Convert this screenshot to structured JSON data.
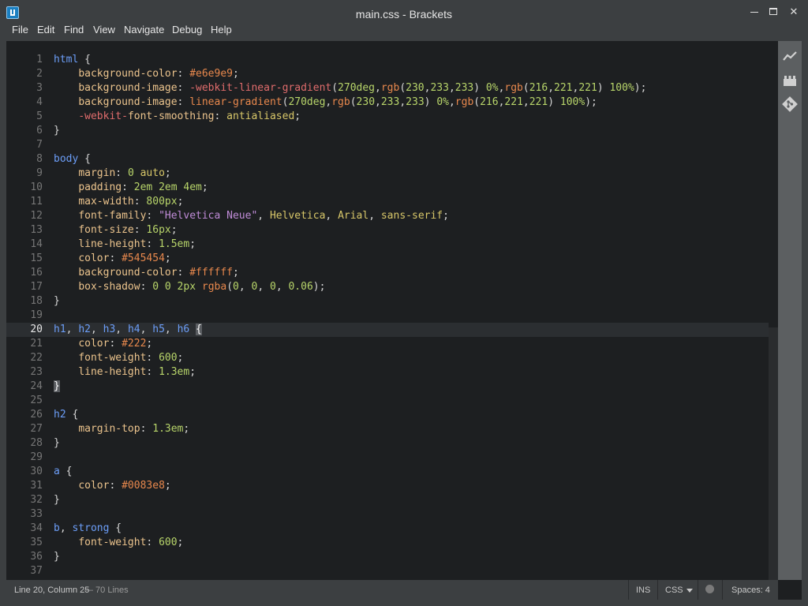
{
  "window": {
    "title": "main.css - Brackets",
    "minimize_glyph": "",
    "maximize_glyph": "",
    "close_glyph": "✕"
  },
  "menu": [
    {
      "label": "File"
    },
    {
      "label": "Edit"
    },
    {
      "label": "Find"
    },
    {
      "label": "View"
    },
    {
      "label": "Navigate"
    },
    {
      "label": "Debug"
    },
    {
      "label": "Help"
    }
  ],
  "editor": {
    "language": "CSS",
    "active_line": 20,
    "lines": [
      {
        "n": "1",
        "tokens": [
          [
            "sel",
            "html"
          ],
          [
            "punc",
            " {"
          ]
        ]
      },
      {
        "n": "2",
        "tokens": [
          [
            "punc",
            "    "
          ],
          [
            "prop",
            "background-color"
          ],
          [
            "punc",
            ": "
          ],
          [
            "hex",
            "#e6e9e9"
          ],
          [
            "punc",
            ";"
          ]
        ]
      },
      {
        "n": "3",
        "tokens": [
          [
            "punc",
            "    "
          ],
          [
            "prop",
            "background-image"
          ],
          [
            "punc",
            ": "
          ],
          [
            "vendor",
            "-webkit-linear-gradient"
          ],
          [
            "punc",
            "("
          ],
          [
            "num",
            "270deg"
          ],
          [
            "punc",
            ","
          ],
          [
            "fn",
            "rgb"
          ],
          [
            "punc",
            "("
          ],
          [
            "num",
            "230"
          ],
          [
            "punc",
            ","
          ],
          [
            "num",
            "233"
          ],
          [
            "punc",
            ","
          ],
          [
            "num",
            "233"
          ],
          [
            "punc",
            ") "
          ],
          [
            "num",
            "0%"
          ],
          [
            "punc",
            ","
          ],
          [
            "fn",
            "rgb"
          ],
          [
            "punc",
            "("
          ],
          [
            "num",
            "216"
          ],
          [
            "punc",
            ","
          ],
          [
            "num",
            "221"
          ],
          [
            "punc",
            ","
          ],
          [
            "num",
            "221"
          ],
          [
            "punc",
            ") "
          ],
          [
            "num",
            "100%"
          ],
          [
            "punc",
            ");"
          ]
        ]
      },
      {
        "n": "4",
        "tokens": [
          [
            "punc",
            "    "
          ],
          [
            "prop",
            "background-image"
          ],
          [
            "punc",
            ": "
          ],
          [
            "fn",
            "linear-gradient"
          ],
          [
            "punc",
            "("
          ],
          [
            "num",
            "270deg"
          ],
          [
            "punc",
            ","
          ],
          [
            "fn",
            "rgb"
          ],
          [
            "punc",
            "("
          ],
          [
            "num",
            "230"
          ],
          [
            "punc",
            ","
          ],
          [
            "num",
            "233"
          ],
          [
            "punc",
            ","
          ],
          [
            "num",
            "233"
          ],
          [
            "punc",
            ") "
          ],
          [
            "num",
            "0%"
          ],
          [
            "punc",
            ","
          ],
          [
            "fn",
            "rgb"
          ],
          [
            "punc",
            "("
          ],
          [
            "num",
            "216"
          ],
          [
            "punc",
            ","
          ],
          [
            "num",
            "221"
          ],
          [
            "punc",
            ","
          ],
          [
            "num",
            "221"
          ],
          [
            "punc",
            ") "
          ],
          [
            "num",
            "100%"
          ],
          [
            "punc",
            ");"
          ]
        ]
      },
      {
        "n": "5",
        "tokens": [
          [
            "punc",
            "    "
          ],
          [
            "vendor",
            "-webkit-"
          ],
          [
            "prop",
            "font-smoothing"
          ],
          [
            "punc",
            ": "
          ],
          [
            "val",
            "antialiased"
          ],
          [
            "punc",
            ";"
          ]
        ]
      },
      {
        "n": "6",
        "tokens": [
          [
            "punc",
            "}"
          ]
        ]
      },
      {
        "n": "7",
        "tokens": []
      },
      {
        "n": "8",
        "tokens": [
          [
            "sel",
            "body"
          ],
          [
            "punc",
            " {"
          ]
        ]
      },
      {
        "n": "9",
        "tokens": [
          [
            "punc",
            "    "
          ],
          [
            "prop",
            "margin"
          ],
          [
            "punc",
            ": "
          ],
          [
            "num",
            "0"
          ],
          [
            "punc",
            " "
          ],
          [
            "val",
            "auto"
          ],
          [
            "punc",
            ";"
          ]
        ]
      },
      {
        "n": "10",
        "tokens": [
          [
            "punc",
            "    "
          ],
          [
            "prop",
            "padding"
          ],
          [
            "punc",
            ": "
          ],
          [
            "num",
            "2em 2em 4em"
          ],
          [
            "punc",
            ";"
          ]
        ]
      },
      {
        "n": "11",
        "tokens": [
          [
            "punc",
            "    "
          ],
          [
            "prop",
            "max-width"
          ],
          [
            "punc",
            ": "
          ],
          [
            "num",
            "800px"
          ],
          [
            "punc",
            ";"
          ]
        ]
      },
      {
        "n": "12",
        "tokens": [
          [
            "punc",
            "    "
          ],
          [
            "prop",
            "font-family"
          ],
          [
            "punc",
            ": "
          ],
          [
            "str",
            "\"Helvetica Neue\""
          ],
          [
            "punc",
            ", "
          ],
          [
            "val",
            "Helvetica"
          ],
          [
            "punc",
            ", "
          ],
          [
            "val",
            "Arial"
          ],
          [
            "punc",
            ", "
          ],
          [
            "val",
            "sans-serif"
          ],
          [
            "punc",
            ";"
          ]
        ]
      },
      {
        "n": "13",
        "tokens": [
          [
            "punc",
            "    "
          ],
          [
            "prop",
            "font-size"
          ],
          [
            "punc",
            ": "
          ],
          [
            "num",
            "16px"
          ],
          [
            "punc",
            ";"
          ]
        ]
      },
      {
        "n": "14",
        "tokens": [
          [
            "punc",
            "    "
          ],
          [
            "prop",
            "line-height"
          ],
          [
            "punc",
            ": "
          ],
          [
            "num",
            "1.5em"
          ],
          [
            "punc",
            ";"
          ]
        ]
      },
      {
        "n": "15",
        "tokens": [
          [
            "punc",
            "    "
          ],
          [
            "prop",
            "color"
          ],
          [
            "punc",
            ": "
          ],
          [
            "hex",
            "#545454"
          ],
          [
            "punc",
            ";"
          ]
        ]
      },
      {
        "n": "16",
        "tokens": [
          [
            "punc",
            "    "
          ],
          [
            "prop",
            "background-color"
          ],
          [
            "punc",
            ": "
          ],
          [
            "hex",
            "#ffffff"
          ],
          [
            "punc",
            ";"
          ]
        ]
      },
      {
        "n": "17",
        "tokens": [
          [
            "punc",
            "    "
          ],
          [
            "prop",
            "box-shadow"
          ],
          [
            "punc",
            ": "
          ],
          [
            "num",
            "0 0 2px"
          ],
          [
            "punc",
            " "
          ],
          [
            "fn",
            "rgba"
          ],
          [
            "punc",
            "("
          ],
          [
            "num",
            "0"
          ],
          [
            "punc",
            ", "
          ],
          [
            "num",
            "0"
          ],
          [
            "punc",
            ", "
          ],
          [
            "num",
            "0"
          ],
          [
            "punc",
            ", "
          ],
          [
            "num",
            "0.06"
          ],
          [
            "punc",
            ");"
          ]
        ]
      },
      {
        "n": "18",
        "tokens": [
          [
            "punc",
            "}"
          ]
        ]
      },
      {
        "n": "19",
        "tokens": []
      },
      {
        "n": "20",
        "tokens": [
          [
            "sel",
            "h1"
          ],
          [
            "punc",
            ", "
          ],
          [
            "sel",
            "h2"
          ],
          [
            "punc",
            ", "
          ],
          [
            "sel",
            "h3"
          ],
          [
            "punc",
            ", "
          ],
          [
            "sel",
            "h4"
          ],
          [
            "punc",
            ", "
          ],
          [
            "sel",
            "h5"
          ],
          [
            "punc",
            ", "
          ],
          [
            "sel",
            "h6"
          ],
          [
            "punc",
            " "
          ],
          [
            "brace",
            "{"
          ]
        ]
      },
      {
        "n": "21",
        "tokens": [
          [
            "punc",
            "    "
          ],
          [
            "prop",
            "color"
          ],
          [
            "punc",
            ": "
          ],
          [
            "hex",
            "#222"
          ],
          [
            "punc",
            ";"
          ]
        ]
      },
      {
        "n": "22",
        "tokens": [
          [
            "punc",
            "    "
          ],
          [
            "prop",
            "font-weight"
          ],
          [
            "punc",
            ": "
          ],
          [
            "num",
            "600"
          ],
          [
            "punc",
            ";"
          ]
        ]
      },
      {
        "n": "23",
        "tokens": [
          [
            "punc",
            "    "
          ],
          [
            "prop",
            "line-height"
          ],
          [
            "punc",
            ": "
          ],
          [
            "num",
            "1.3em"
          ],
          [
            "punc",
            ";"
          ]
        ]
      },
      {
        "n": "24",
        "tokens": [
          [
            "brace",
            "}"
          ]
        ]
      },
      {
        "n": "25",
        "tokens": []
      },
      {
        "n": "26",
        "tokens": [
          [
            "sel",
            "h2"
          ],
          [
            "punc",
            " {"
          ]
        ]
      },
      {
        "n": "27",
        "tokens": [
          [
            "punc",
            "    "
          ],
          [
            "prop",
            "margin-top"
          ],
          [
            "punc",
            ": "
          ],
          [
            "num",
            "1.3em"
          ],
          [
            "punc",
            ";"
          ]
        ]
      },
      {
        "n": "28",
        "tokens": [
          [
            "punc",
            "}"
          ]
        ]
      },
      {
        "n": "29",
        "tokens": []
      },
      {
        "n": "30",
        "tokens": [
          [
            "sel",
            "a"
          ],
          [
            "punc",
            " {"
          ]
        ]
      },
      {
        "n": "31",
        "tokens": [
          [
            "punc",
            "    "
          ],
          [
            "prop",
            "color"
          ],
          [
            "punc",
            ": "
          ],
          [
            "hex",
            "#0083e8"
          ],
          [
            "punc",
            ";"
          ]
        ]
      },
      {
        "n": "32",
        "tokens": [
          [
            "punc",
            "}"
          ]
        ]
      },
      {
        "n": "33",
        "tokens": []
      },
      {
        "n": "34",
        "tokens": [
          [
            "sel",
            "b"
          ],
          [
            "punc",
            ", "
          ],
          [
            "sel",
            "strong"
          ],
          [
            "punc",
            " {"
          ]
        ]
      },
      {
        "n": "35",
        "tokens": [
          [
            "punc",
            "    "
          ],
          [
            "prop",
            "font-weight"
          ],
          [
            "punc",
            ": "
          ],
          [
            "num",
            "600"
          ],
          [
            "punc",
            ";"
          ]
        ]
      },
      {
        "n": "36",
        "tokens": [
          [
            "punc",
            "}"
          ]
        ]
      },
      {
        "n": "37",
        "tokens": []
      }
    ]
  },
  "toolbar": [
    {
      "name": "live-preview-icon"
    },
    {
      "name": "extension-manager-icon"
    },
    {
      "name": "git-icon"
    }
  ],
  "status": {
    "cursor": "Line 20, Column 25",
    "lines": " — 70 Lines",
    "mode": "INS",
    "language": "CSS",
    "spaces": "Spaces: 4"
  },
  "colors": {
    "chrome": "#3c3f41",
    "editor_bg": "#1d1f21",
    "toolbar_bg": "#5c5f61"
  }
}
